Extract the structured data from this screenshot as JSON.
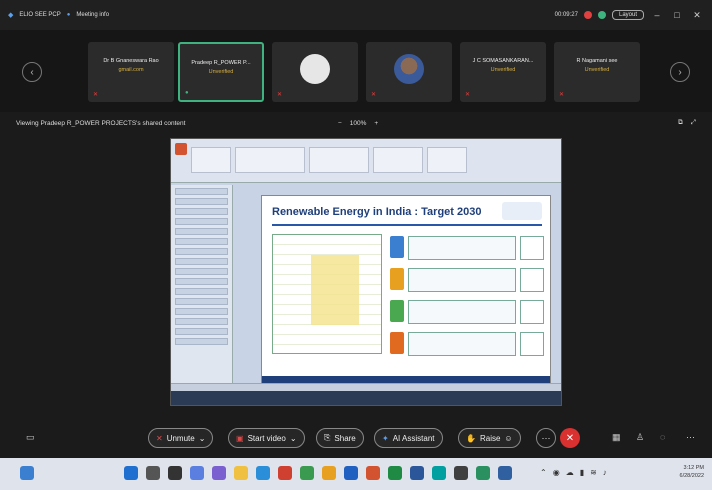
{
  "topbar": {
    "app_label": "ELIO SEE PCP",
    "meeting_info": "Meeting info",
    "timer": "00:09:27",
    "layout_label": "Layout"
  },
  "gallery": {
    "participants": [
      {
        "name": "Dr B Gnaneswara Rao",
        "status": "gmail.com"
      },
      {
        "name": "Pradeep R_POWER P...",
        "status": "Unverified",
        "active": true
      },
      {
        "name": "",
        "status": "",
        "avatar": "emblem"
      },
      {
        "name": "",
        "status": "",
        "avatar": "photo"
      },
      {
        "name": "J C SOMASANKARAN...",
        "status": "Unverified"
      },
      {
        "name": "R Nagamani see",
        "status": "Unverified"
      }
    ]
  },
  "viewing": {
    "label": "Viewing Pradeep R_POWER PROJECTS's shared content",
    "zoom": "100%"
  },
  "slide": {
    "title": "Renewable Energy in India : Target 2030"
  },
  "controls": {
    "unmute": "Unmute",
    "start_video": "Start video",
    "share": "Share",
    "ai_assistant": "AI Assistant",
    "raise": "Raise"
  },
  "taskbar": {
    "time": "3:12 PM",
    "date": "6/28/2022"
  },
  "colors": {
    "accent_green": "#3fb37f",
    "leave_red": "#d93030",
    "unverified_gold": "#d8b040"
  }
}
